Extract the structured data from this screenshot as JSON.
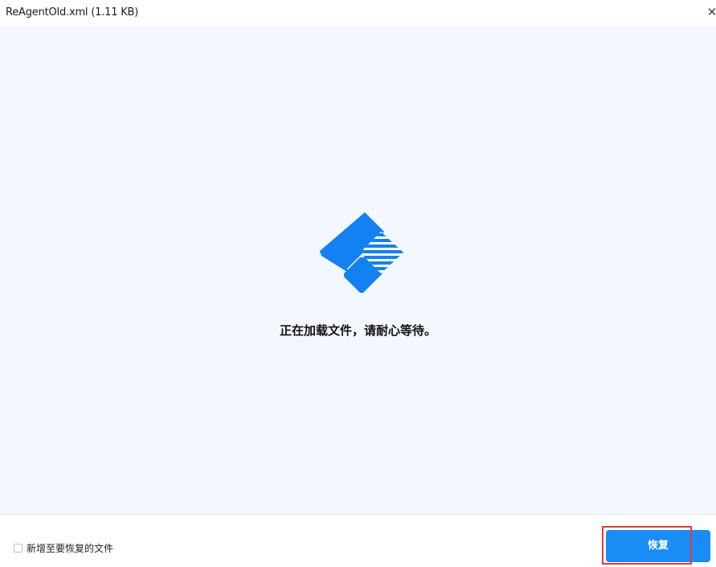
{
  "window": {
    "title": "ReAgentOld.xml (1.11 KB)",
    "close_icon": "close-icon"
  },
  "main": {
    "logo_icon": "app-logo-icon",
    "loading_message": "正在加载文件，请耐心等待。"
  },
  "footer": {
    "checkbox_label": "新增至要恢复的文件",
    "checkbox_checked": false,
    "recover_button_label": "恢复"
  },
  "colors": {
    "accent": "#1a8cf5",
    "content_background": "#f3f7fe",
    "highlight": "#e53935"
  }
}
